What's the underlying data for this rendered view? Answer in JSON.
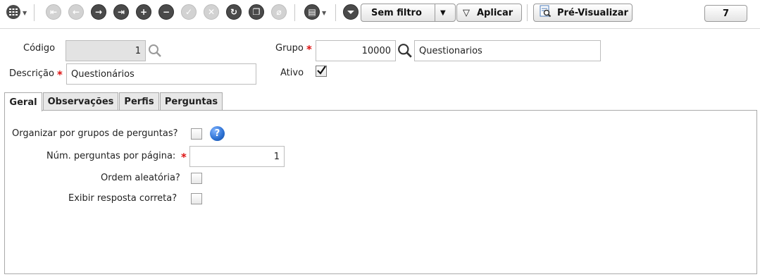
{
  "toolbar": {
    "filter_label": "Sem filtro",
    "apply_label": "Aplicar",
    "preview_label": "Pré-Visualizar",
    "counter": "7",
    "icons": [
      "grid-menu-icon",
      "first-record-icon",
      "previous-record-icon",
      "next-record-icon",
      "last-record-icon",
      "add-record-icon",
      "remove-record-icon",
      "confirm-icon",
      "cancel-icon",
      "refresh-icon",
      "copy-icon",
      "attach-icon",
      "document-menu-icon",
      "filter-funnel-icon",
      "funnel-icon",
      "preview-icon"
    ]
  },
  "form": {
    "codigo_label": "Código",
    "codigo_value": "1",
    "descricao_label": "Descrição",
    "descricao_value": "Questionários",
    "grupo_label": "Grupo",
    "grupo_code": "10000",
    "grupo_name": "Questionarios",
    "ativo_label": "Ativo",
    "ativo_checked": true
  },
  "tabs": [
    {
      "label": "Geral",
      "active": true
    },
    {
      "label": "Observações",
      "active": false
    },
    {
      "label": "Perfis",
      "active": false
    },
    {
      "label": "Perguntas",
      "active": false
    }
  ],
  "geral": {
    "organizar_label": "Organizar por grupos de perguntas?",
    "num_perguntas_label": "Núm. perguntas por página:",
    "num_perguntas_value": "1",
    "ordem_label": "Ordem aleatória?",
    "exibir_label": "Exibir resposta correta?"
  },
  "colors": {
    "required": "#dd1111",
    "help_icon": "#2a6fd1"
  }
}
